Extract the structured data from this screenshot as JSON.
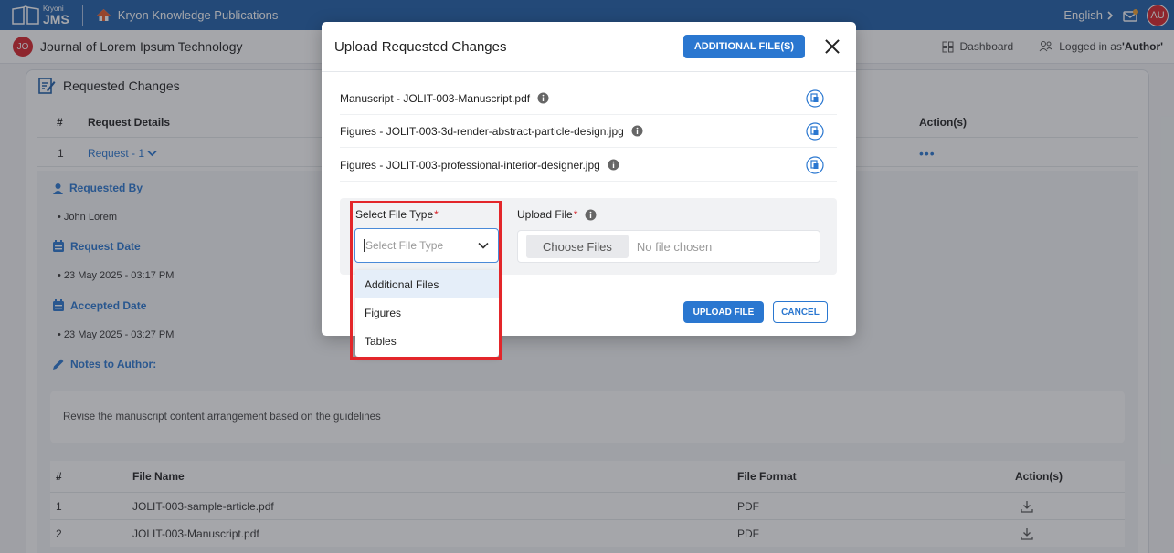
{
  "topbar": {
    "brand_small": "Kryoni",
    "brand_big": "JMS",
    "publication": "Kryon Knowledge Publications",
    "language": "English",
    "avatar": "AU"
  },
  "subbar": {
    "journal_badge": "JO",
    "journal_title": "Journal of Lorem Ipsum Technology",
    "dashboard": "Dashboard",
    "logged_in_prefix": "Logged in as ",
    "logged_in_role": "'Author'"
  },
  "requested_changes": {
    "title": "Requested Changes",
    "col_num": "#",
    "col_details": "Request Details",
    "col_actions": "Action(s)",
    "row_num": "1",
    "row_request": "Request - 1",
    "requested_by_label": "Requested By",
    "requested_by_value": "John Lorem",
    "request_date_label": "Request Date",
    "request_date_value": "23 May 2025 - 03:17 PM",
    "accepted_date_label": "Accepted Date",
    "accepted_date_value": "23 May 2025 - 03:27 PM",
    "notes_label": "Notes to Author:",
    "notes_value": "Revise the manuscript content arrangement based on the guidelines"
  },
  "files_table": {
    "col_num": "#",
    "col_name": "File Name",
    "col_format": "File Format",
    "col_actions": "Action(s)",
    "rows": [
      {
        "num": "1",
        "name": "JOLIT-003-sample-article.pdf",
        "format": "PDF"
      },
      {
        "num": "2",
        "name": "JOLIT-003-Manuscript.pdf",
        "format": "PDF"
      }
    ]
  },
  "modal": {
    "title": "Upload Requested Changes",
    "additional_button": "ADDITIONAL FILE(S)",
    "files": [
      {
        "type": "Manuscript - ",
        "name": "JOLIT-003-Manuscript.pdf"
      },
      {
        "type": "Figures - ",
        "name": "JOLIT-003-3d-render-abstract-particle-design.jpg"
      },
      {
        "type": "Figures - ",
        "name": "JOLIT-003-professional-interior-designer.jpg"
      }
    ],
    "select_label": "Select File Type",
    "select_placeholder": "Select File Type",
    "upload_label": "Upload File",
    "choose_files": "Choose Files",
    "no_file": "No file chosen",
    "options": [
      "Additional Files",
      "Figures",
      "Tables"
    ],
    "upload_button": "UPLOAD FILE",
    "cancel_button": "CANCEL"
  },
  "colors": {
    "primary": "#2a77d0",
    "topbar": "#1f5faa",
    "highlight": "#e3262a"
  }
}
